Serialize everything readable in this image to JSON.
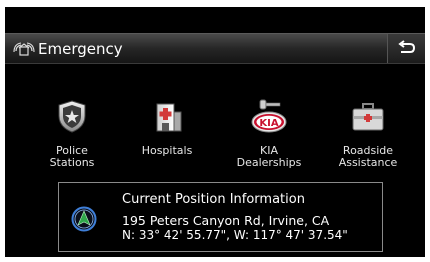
{
  "header": {
    "title": "Emergency",
    "icon": "emergency-call-icon",
    "back_icon": "back-arrow-icon"
  },
  "menu": [
    {
      "label_line1": "Police",
      "label_line2": "Stations",
      "icon": "police-badge-icon"
    },
    {
      "label_line1": "Hospitals",
      "label_line2": "",
      "icon": "hospital-icon"
    },
    {
      "label_line1": "KIA",
      "label_line2": "Dealerships",
      "icon": "kia-dealer-icon"
    },
    {
      "label_line1": "Roadside",
      "label_line2": "Assistance",
      "icon": "roadside-toolbox-icon"
    }
  ],
  "position": {
    "title": "Current Position Information",
    "address": "195 Peters Canyon Rd, Irvine, CA",
    "coordinates": "N: 33° 42' 55.77\", W: 117° 47' 37.54\"",
    "icon": "compass-arrow-icon"
  },
  "colors": {
    "background": "#000000",
    "compass_green": "#2fa84a",
    "compass_ring": "#3f7fd8"
  }
}
